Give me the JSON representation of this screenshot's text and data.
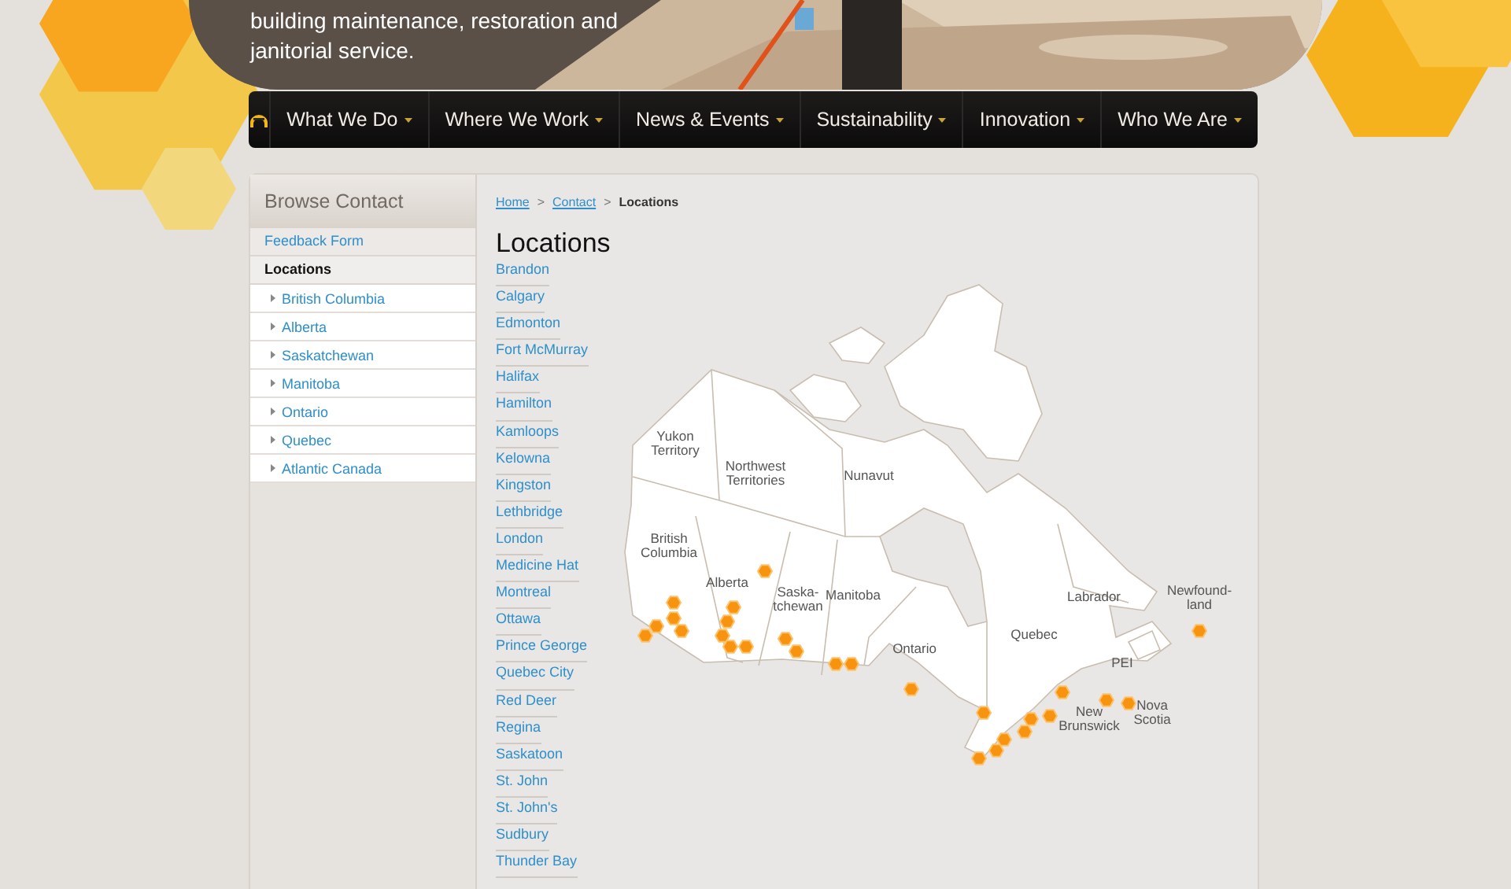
{
  "banner": {
    "tagline": [
      "building maintenance, restoration and",
      "janitorial service."
    ]
  },
  "nav": {
    "home": {
      "kind": "home-icon"
    },
    "items": [
      {
        "label": "What We Do",
        "has_menu": true
      },
      {
        "label": "Where We Work",
        "has_menu": true
      },
      {
        "label": "News & Events",
        "has_menu": true
      },
      {
        "label": "Sustainability",
        "has_menu": true
      },
      {
        "label": "Innovation",
        "has_menu": true
      },
      {
        "label": "Who We Are",
        "has_menu": true
      }
    ]
  },
  "sidebar": {
    "title": "Browse Contact",
    "items": [
      {
        "label": "Feedback Form",
        "selected": false
      },
      {
        "label": "Locations",
        "selected": true,
        "children": [
          {
            "label": "British Columbia"
          },
          {
            "label": "Alberta"
          },
          {
            "label": "Saskatchewan"
          },
          {
            "label": "Manitoba"
          },
          {
            "label": "Ontario"
          },
          {
            "label": "Quebec"
          },
          {
            "label": "Atlantic Canada"
          }
        ]
      }
    ]
  },
  "breadcrumb": [
    {
      "label": "Home",
      "current": false
    },
    {
      "label": "Contact",
      "current": false
    },
    {
      "label": "Locations",
      "current": true
    }
  ],
  "breadcrumb_separator": ">",
  "page_title": "Locations",
  "locations": [
    "Brandon",
    "Calgary",
    "Edmonton",
    "Fort McMurray",
    "Halifax",
    "Hamilton",
    "Kamloops",
    "Kelowna",
    "Kingston",
    "Lethbridge",
    "London",
    "Medicine Hat",
    "Montreal",
    "Ottawa",
    "Prince George",
    "Quebec City",
    "Red Deer",
    "Regina",
    "Saskatoon",
    "St. John",
    "St. John's",
    "Sudbury",
    "Thunder Bay"
  ],
  "map": {
    "regions": [
      [
        "Yukon",
        "Territory"
      ],
      [
        "Northwest",
        "Territories"
      ],
      [
        "Nunavut"
      ],
      [
        "British",
        "Columbia"
      ],
      [
        "Alberta"
      ],
      [
        "Saska-",
        "tchewan"
      ],
      [
        "Manitoba"
      ],
      [
        "Ontario"
      ],
      [
        "Quebec"
      ],
      [
        "Labrador"
      ],
      [
        "Newfound-",
        "land"
      ],
      [
        "PEI"
      ],
      [
        "New",
        "Brunswick"
      ],
      [
        "Nova",
        "Scotia"
      ]
    ]
  }
}
